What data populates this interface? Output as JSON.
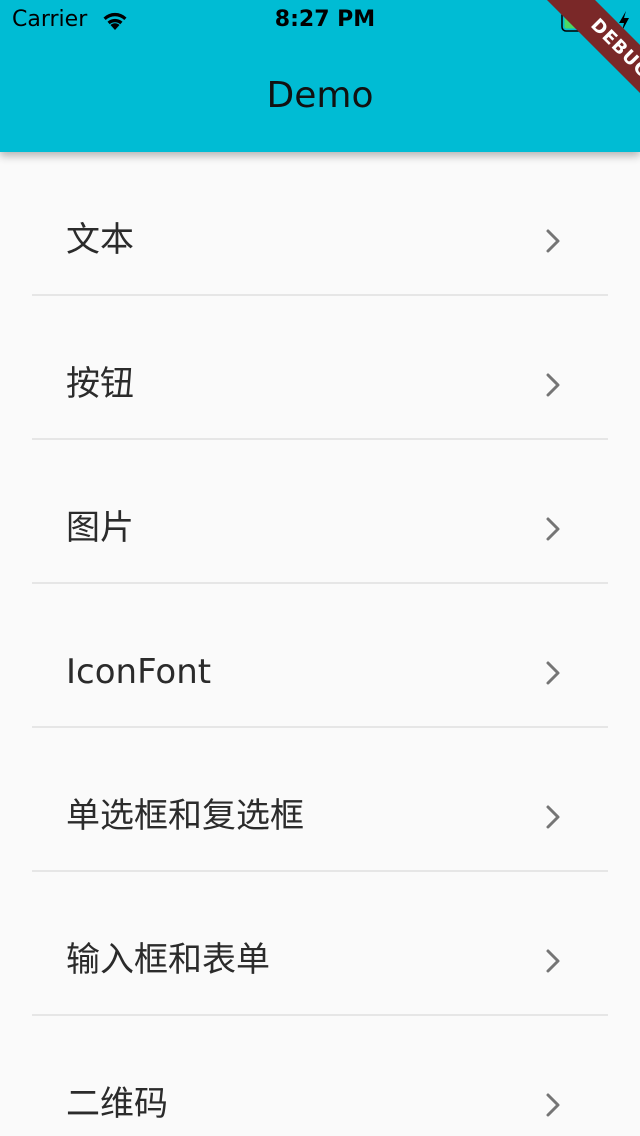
{
  "status_bar": {
    "carrier": "Carrier",
    "time": "8:27 PM",
    "wifi_icon": "wifi-icon",
    "battery_icon": "battery-icon",
    "charging_icon": "charging-bolt-icon",
    "battery_level": 0.9
  },
  "app_bar": {
    "title": "Demo",
    "color": "#00bcd4"
  },
  "debug_banner": {
    "label": "DEBUG",
    "color": "#7a2828"
  },
  "menu": {
    "items": [
      {
        "label": "文本",
        "icon": "chevron-right-icon"
      },
      {
        "label": "按钮",
        "icon": "chevron-right-icon"
      },
      {
        "label": "图片",
        "icon": "chevron-right-icon"
      },
      {
        "label": "IconFont",
        "icon": "chevron-right-icon"
      },
      {
        "label": "单选框和复选框",
        "icon": "chevron-right-icon"
      },
      {
        "label": "输入框和表单",
        "icon": "chevron-right-icon"
      },
      {
        "label": "二维码",
        "icon": "chevron-right-icon"
      }
    ]
  }
}
